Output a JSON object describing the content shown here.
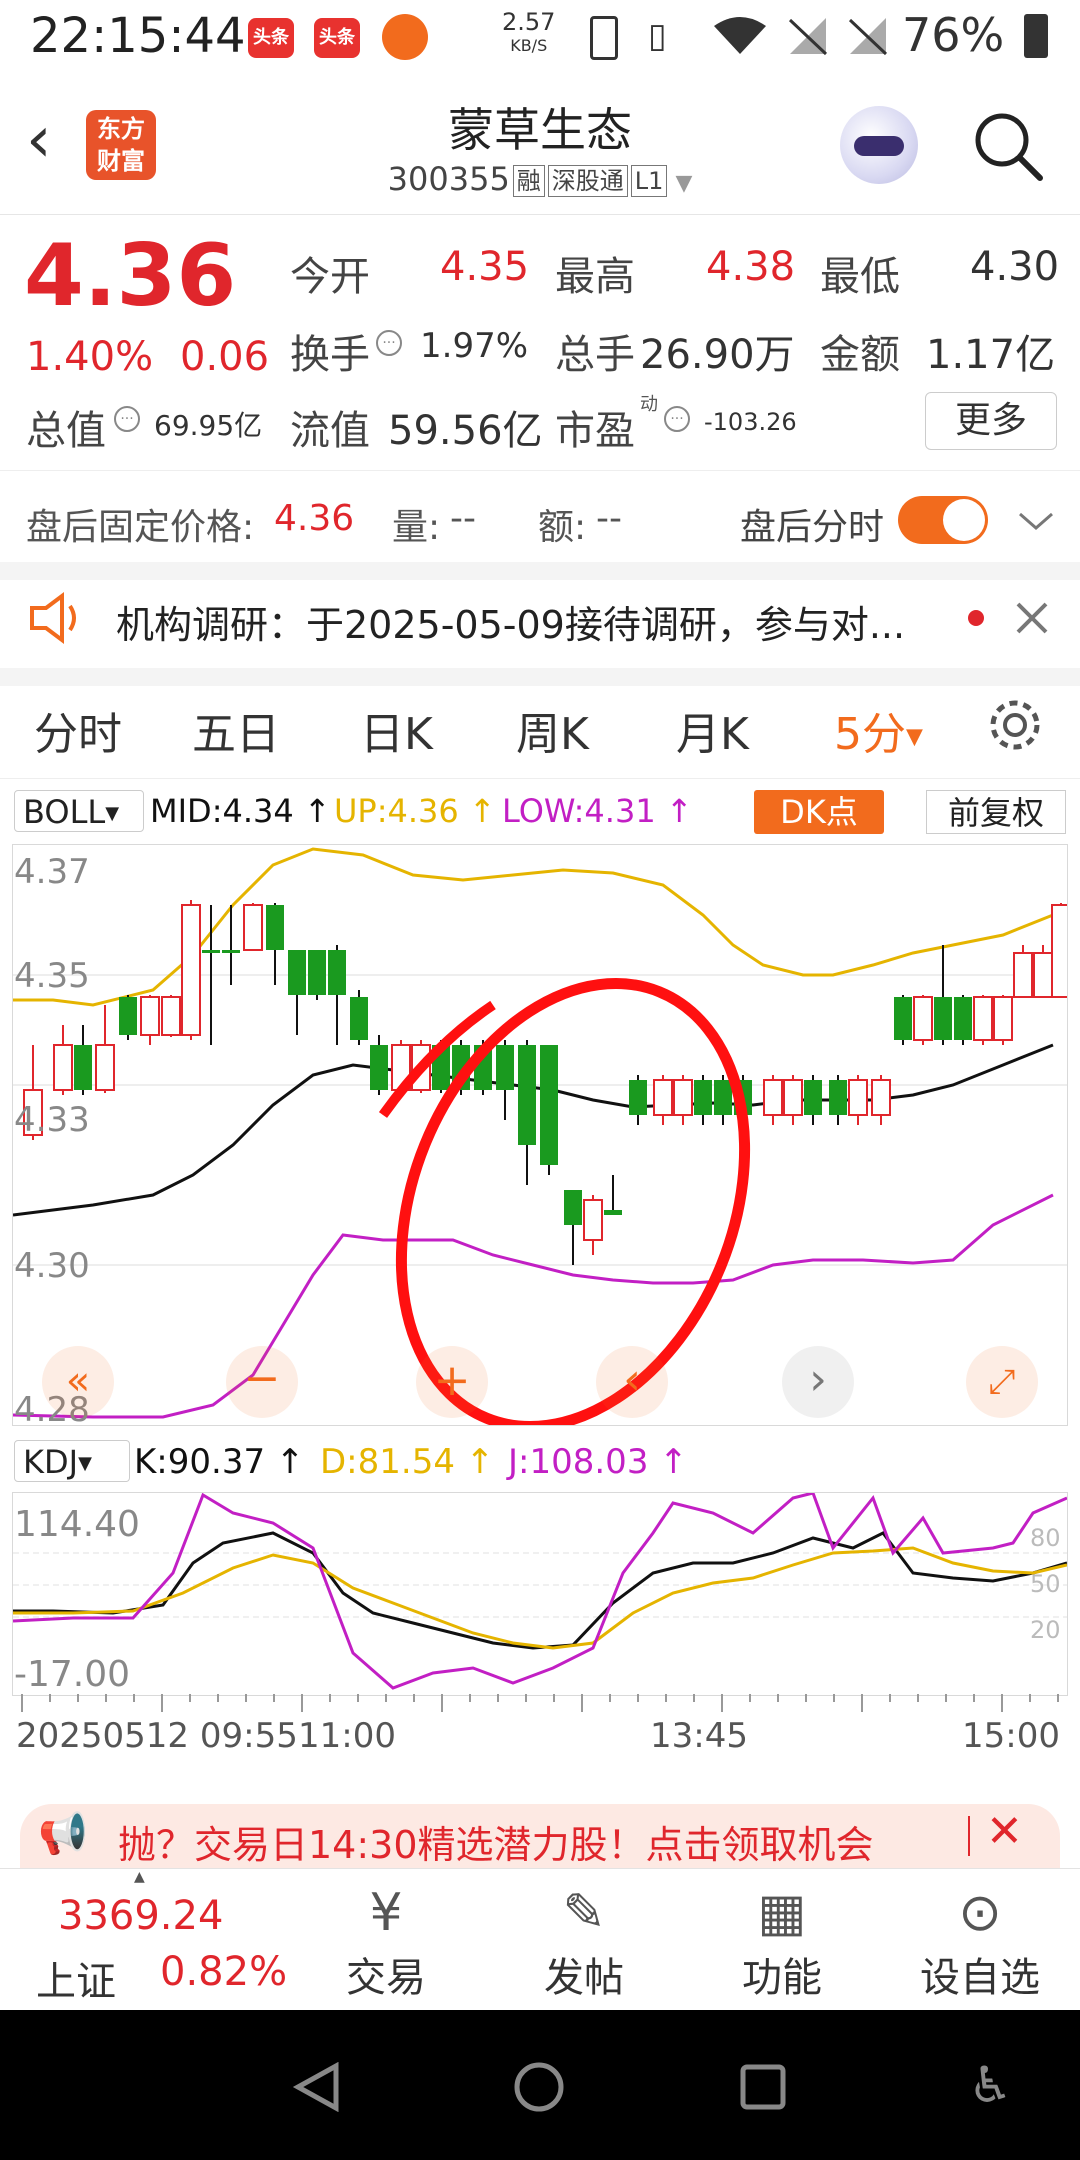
{
  "status": {
    "time": "22:15:44",
    "net_speed_value": "2.57",
    "net_speed_unit": "KB/S",
    "battery": "76%",
    "app_badge_1": "头条",
    "app_badge_2": "头条"
  },
  "header": {
    "back": "‹",
    "logo_line1": "东方",
    "logo_line2": "财富",
    "title": "蒙草生态",
    "code": "300355",
    "tags": [
      "融",
      "深股通",
      "L1"
    ]
  },
  "quote": {
    "price": "4.36",
    "change_pct": "1.40%",
    "change": "0.06",
    "open_label": "今开",
    "open": "4.35",
    "high_label": "最高",
    "high": "4.38",
    "low_label": "最低",
    "low": "4.30",
    "turnover_label": "换手",
    "turnover": "1.97%",
    "volume_label": "总手",
    "volume": "26.90万",
    "amount_label": "金额",
    "amount": "1.17亿",
    "mktcap_label": "总值",
    "mktcap": "69.95亿",
    "float_label": "流值",
    "float": "59.56亿",
    "pe_label": "市盈",
    "pe_sup": "动",
    "pe": "-103.26",
    "more": "更多"
  },
  "afterhours": {
    "price_label": "盘后固定价格:",
    "price": "4.36",
    "vol_label": "量:",
    "vol": "--",
    "amt_label": "额:",
    "amt": "--",
    "toggle_label": "盘后分时",
    "toggle_on": true
  },
  "notice": {
    "text": "机构调研：于2025-05-09接待调研，参与对..."
  },
  "tabs": [
    {
      "label": "分时"
    },
    {
      "label": "五日"
    },
    {
      "label": "日K"
    },
    {
      "label": "周K"
    },
    {
      "label": "月K"
    },
    {
      "label": "5分",
      "active": true
    }
  ],
  "boll": {
    "name": "BOLL",
    "mid": "MID:4.34",
    "up": "UP:4.36",
    "low": "LOW:4.31",
    "dk": "DK点",
    "adjust": "前复权",
    "y_ticks": [
      "4.37",
      "4.35",
      "4.33",
      "4.30",
      "4.28"
    ]
  },
  "kdj": {
    "name": "KDJ",
    "k": "K:90.37",
    "d": "D:81.54",
    "j": "J:108.03",
    "y_top": "114.40",
    "y_bottom": "-17.00",
    "levels": [
      "80",
      "50",
      "20"
    ]
  },
  "time_axis": [
    "20250512 09:55",
    "11:00",
    "13:45",
    "15:00"
  ],
  "ad": {
    "text": "抛？交易日14:30精选潜力股！点击领取机会"
  },
  "bottom_nav": {
    "index_value": "3369.24",
    "index_name": "上证",
    "index_pct": "0.82%",
    "trade": "交易",
    "post": "发帖",
    "func": "功能",
    "watch": "设自选"
  },
  "colors": {
    "up": "#e0262c",
    "down": "#1a9a1f",
    "mid": "#111111",
    "upper": "#e5b400",
    "lower": "#c21fc4",
    "accent": "#f26b1d"
  }
}
